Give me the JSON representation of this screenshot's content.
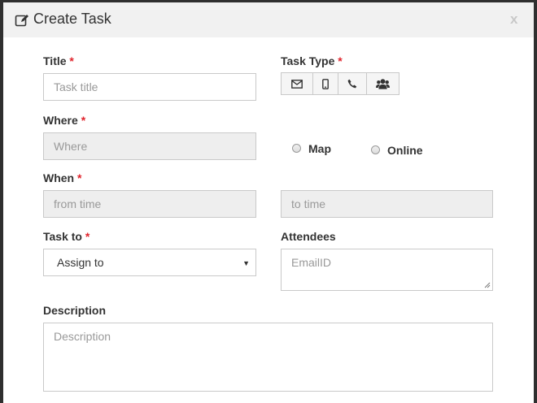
{
  "modal": {
    "title": "Create Task",
    "close_label": "x"
  },
  "form": {
    "required_mark": "*",
    "title": {
      "label": "Title",
      "placeholder": "Task title"
    },
    "task_type": {
      "label": "Task Type",
      "buttons": [
        {
          "icon": "envelope-icon"
        },
        {
          "icon": "mobile-icon"
        },
        {
          "icon": "phone-icon"
        },
        {
          "icon": "group-icon"
        }
      ]
    },
    "where": {
      "label": "Where",
      "placeholder": "Where",
      "options": [
        "Map",
        "Online"
      ]
    },
    "when": {
      "label": "When",
      "from_placeholder": "from time",
      "to_placeholder": "to time"
    },
    "task_to": {
      "label": "Task to",
      "selected": "Assign to"
    },
    "attendees": {
      "label": "Attendees",
      "placeholder": "EmailID"
    },
    "description": {
      "label": "Description",
      "placeholder": "Description"
    }
  }
}
